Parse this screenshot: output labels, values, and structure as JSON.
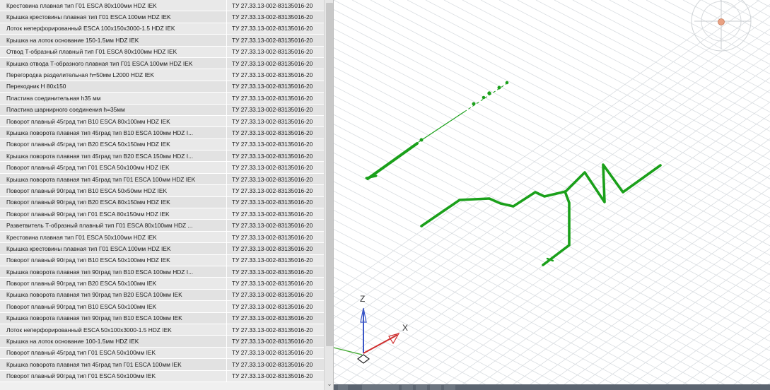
{
  "table": {
    "rows": [
      {
        "name": "Крестовина плавная тип Г01 ESCA 80x100мм HDZ IEK",
        "code": "ТУ 27.33.13-002-83135016-20"
      },
      {
        "name": "Крышка крестовины плавная тип Г01 ESCA 100мм HDZ IEK",
        "code": "ТУ 27.33.13-002-83135016-20"
      },
      {
        "name": "Лоток неперфорированный ESCA 100x150x3000-1.5 HDZ IEK",
        "code": "ТУ 27.33.13-002-83135016-20"
      },
      {
        "name": "Крышка на лоток основание 150-1.5мм HDZ IEK",
        "code": "ТУ 27.33.13-002-83135016-20"
      },
      {
        "name": "Отвод Т-образный плавный тип Г01 ESCA 80x100мм HDZ IEK",
        "code": "ТУ 27.33.13-002-83135016-20"
      },
      {
        "name": "Крышка отвода Т-образного плавная тип Г01 ESCA 100мм HDZ IEK",
        "code": "ТУ 27.33.13-002-83135016-20"
      },
      {
        "name": "Перегородка разделительная h=50мм L2000 HDZ IEK",
        "code": "ТУ 27.33.13-002-83135016-20"
      },
      {
        "name": "Переходник Н 80x150",
        "code": "ТУ 27.33.13-002-83135016-20"
      },
      {
        "name": "Пластина соединительная h35 мм",
        "code": "ТУ 27.33.13-002-83135016-20"
      },
      {
        "name": "Пластина шарнирного соединения h=35мм",
        "code": "ТУ 27.33.13-002-83135016-20"
      },
      {
        "name": "Поворот плавный 45град тип В10 ESCA 80x100мм HDZ IEK",
        "code": "ТУ 27.33.13-002-83135016-20"
      },
      {
        "name": "Крышка поворота плавная тип 45град тип В10 ESCA 100мм HDZ I...",
        "code": "ТУ 27.33.13-002-83135016-20"
      },
      {
        "name": "Поворот плавный 45град тип В20 ESCA 50x150мм HDZ IEK",
        "code": "ТУ 27.33.13-002-83135016-20"
      },
      {
        "name": "Крышка поворота плавная тип 45град тип В20 ESCA 150мм HDZ I...",
        "code": "ТУ 27.33.13-002-83135016-20"
      },
      {
        "name": "Поворот плавный 45град тип Г01 ESCA 50x100мм HDZ IEK",
        "code": "ТУ 27.33.13-002-83135016-20"
      },
      {
        "name": "Крышка поворота плавная тип 45град тип Г01 ESCA 100мм HDZ IEK",
        "code": "ТУ 27.33.13-002-83135016-20"
      },
      {
        "name": "Поворот плавный 90град тип В10 ESCA 50x50мм HDZ IEK",
        "code": "ТУ 27.33.13-002-83135016-20"
      },
      {
        "name": "Поворот плавный 90град тип В20 ESCA 80x150мм HDZ IEK",
        "code": "ТУ 27.33.13-002-83135016-20"
      },
      {
        "name": "Поворот плавный 90град тип Г01 ESCA 80x150мм HDZ IEK",
        "code": "ТУ 27.33.13-002-83135016-20"
      },
      {
        "name": "Разветвитель Т-образный плавный тип Г01 ESCA 80x100мм HDZ ...",
        "code": "ТУ 27.33.13-002-83135016-20"
      },
      {
        "name": "Крестовина плавная тип Г01 ESCA 50x100мм HDZ IEK",
        "code": "ТУ 27.33.13-002-83135016-20"
      },
      {
        "name": "Крышка крестовины плавная тип Г01 ESCA 100мм HDZ IEK",
        "code": "ТУ 27.33.13-002-83135016-20"
      },
      {
        "name": "Поворот плавный 90град тип В10 ESCA 50x100мм HDZ IEK",
        "code": "ТУ 27.33.13-002-83135016-20"
      },
      {
        "name": "Крышка поворота плавная тип 90град тип В10 ESCA 100мм HDZ I...",
        "code": "ТУ 27.33.13-002-83135016-20"
      },
      {
        "name": "Поворот плавный 90град тип В20 ESCA 50x100мм IEK",
        "code": "ТУ 27.33.13-002-83135016-20"
      },
      {
        "name": "Крышка поворота плавная тип 90град тип В20 ESCA 100мм IEK",
        "code": "ТУ 27.33.13-002-83135016-20"
      },
      {
        "name": "Поворот плавный 90град тип В10 ESCA 50x100мм IEK",
        "code": "ТУ 27.33.13-002-83135016-20"
      },
      {
        "name": "Крышка поворота плавная тип 90град тип В10 ESCA 100мм IEK",
        "code": "ТУ 27.33.13-002-83135016-20"
      },
      {
        "name": "Лоток неперфорированный ESCA 50x100x3000-1.5 HDZ IEK",
        "code": "ТУ 27.33.13-002-83135016-20"
      },
      {
        "name": "Крышка на лоток основание 100-1.5мм HDZ IEK",
        "code": "ТУ 27.33.13-002-83135016-20"
      },
      {
        "name": "Поворот плавный 45град тип Г01 ESCA 50x100мм IEK",
        "code": "ТУ 27.33.13-002-83135016-20"
      },
      {
        "name": "Крышка поворота плавная тип 45град тип Г01 ESCA 100мм IEK",
        "code": "ТУ 27.33.13-002-83135016-20"
      },
      {
        "name": "Поворот плавный 90град тип Г01 ESCA 50x100мм IEK",
        "code": "ТУ 27.33.13-002-83135016-20"
      }
    ]
  },
  "scrollbar": {
    "down_arrow": "⌄"
  },
  "viewport": {
    "axis_z_label": "Z",
    "axis_x_label": "X",
    "model_color": "#1aa01a",
    "grid_color": "#d9dde1"
  }
}
